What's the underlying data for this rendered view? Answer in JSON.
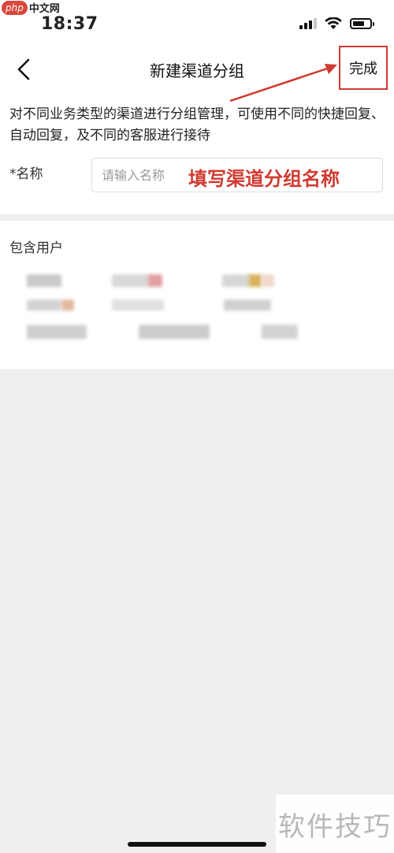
{
  "status_bar": {
    "watermark_badge": "php",
    "watermark_name": "中文网",
    "time": "18:37"
  },
  "nav": {
    "title": "新建渠道分组",
    "done_label": "完成"
  },
  "form": {
    "description": "对不同业务类型的渠道进行分组管理，可使用不同的快捷回复、自动回复，及不同的客服进行接待",
    "name_label": "*名称",
    "name_placeholder": "请输入名称",
    "name_value": "",
    "annotation": "填写渠道分组名称"
  },
  "users": {
    "title": "包含用户"
  },
  "footer": {
    "watermark": "软件技巧"
  },
  "colors": {
    "accent_red": "#d13a30",
    "page_background": "#efefef"
  },
  "icons": {
    "back": "chevron-left-icon",
    "signal": "cellular-signal-icon",
    "wifi": "wifi-icon",
    "battery": "battery-icon"
  }
}
